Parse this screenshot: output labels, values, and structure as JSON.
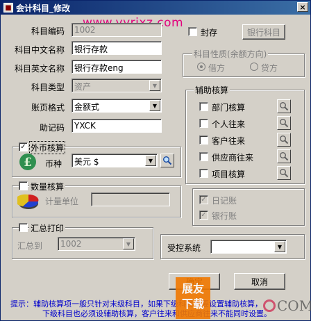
{
  "window": {
    "title": "会计科目_修改",
    "close_glyph": "×"
  },
  "watermark": {
    "url": "www.yyrjxz.com",
    "logo_line1": "展友",
    "logo_line2": "下载",
    "com": "COM"
  },
  "form": {
    "code": {
      "label": "科目编码",
      "value": "1002"
    },
    "cn_name": {
      "label": "科目中文名称",
      "value": "银行存款"
    },
    "en_name": {
      "label": "科目英文名称",
      "value": "银行存款eng"
    },
    "type": {
      "label": "科目类型",
      "value": "资产"
    },
    "page_format": {
      "label": "账页格式",
      "value": "金额式"
    },
    "mnemonic": {
      "label": "助记码",
      "value": "YXCK"
    }
  },
  "seal": {
    "label": "封存",
    "button_label": "银行科目"
  },
  "nature": {
    "title": "科目性质(余额方向)",
    "debit": "借方",
    "credit": "贷方"
  },
  "aux": {
    "title": "辅助核算",
    "items": [
      {
        "label": "部门核算"
      },
      {
        "label": "个人往来"
      },
      {
        "label": "客户往来"
      },
      {
        "label": "供应商往来"
      },
      {
        "label": "项目核算"
      }
    ]
  },
  "foreign": {
    "title": "外币核算",
    "check": "✓",
    "currency_label": "币种",
    "currency_value": "美元 $"
  },
  "quantity": {
    "title": "数量核算",
    "unit_label": "计量单位",
    "unit_value": ""
  },
  "ledger": {
    "journal": "日记账",
    "bank": "银行账",
    "check": "✓"
  },
  "summary": {
    "title": "汇总打印",
    "to_label": "汇总到",
    "to_value": "1002"
  },
  "controlled": {
    "label": "受控系统",
    "value": ""
  },
  "buttons": {
    "ok": "确定",
    "cancel": "取消"
  },
  "hint": {
    "line1": "提示：辅助核算项一般只针对末级科目，如果下级科目也要设置辅助核算，",
    "line2": "下级科目也必须设辅助核算，客户往来和供应商往来不能同时设置。"
  }
}
